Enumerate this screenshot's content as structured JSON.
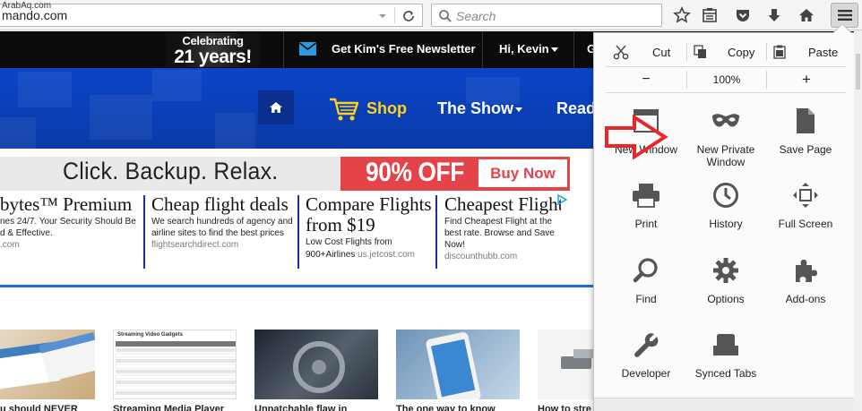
{
  "watermark": "ArabAq.com",
  "toolbar": {
    "url": "mando.com",
    "search_placeholder": "Search"
  },
  "site": {
    "celebrating_top": "Celebrating",
    "celebrating_big": "21 years!",
    "newsletter": "Get Kim's Free Newsletter",
    "greeting": "Hi, Kevin",
    "topbar_cut": "G",
    "nav": {
      "shop": "Shop",
      "show": "The Show",
      "read": "Read"
    }
  },
  "banner_ad": {
    "headline": "Click. Backup. Relax.",
    "offer": "90% OFF",
    "button": "Buy Now"
  },
  "text_ads": [
    {
      "title": "bytes™ Premium",
      "desc": "nes 24/7. Your Security Should Be d & Effective.",
      "url": ".com"
    },
    {
      "title": "Cheap flight deals",
      "desc": "We search hundreds of agency and airline sites to find the best prices",
      "url": "flightsearchdirect.com"
    },
    {
      "title": "Compare Flights from $19",
      "title_line1": "Compare Flights",
      "title_line2": "from $19",
      "desc": "Low Cost Flights from",
      "desc2": "900+Airlines",
      "url": "us.jetcost.com"
    },
    {
      "title": "Cheapest Flight",
      "desc": "Find Cheapest Flight at the best rate. Browse and Save Now!",
      "url": "discounthubb.com"
    }
  ],
  "articles": [
    {
      "caption": "u should NEVER"
    },
    {
      "caption": "Streaming Media Player",
      "thumb_title": "Streaming Video Gadgets"
    },
    {
      "caption": "Unpatchable flaw in"
    },
    {
      "caption": "The one way to know"
    },
    {
      "caption": "How to stre"
    }
  ],
  "menu": {
    "edit": {
      "cut": "Cut",
      "copy": "Copy",
      "paste": "Paste"
    },
    "zoom": {
      "out": "−",
      "level": "100%",
      "in": "+"
    },
    "items": [
      {
        "label": "New Window",
        "icon": "new-window-icon"
      },
      {
        "label": "New Private Window",
        "line1": "New Private",
        "line2": "Window",
        "icon": "private-mask-icon"
      },
      {
        "label": "Save Page",
        "icon": "save-page-icon"
      },
      {
        "label": "Print",
        "icon": "print-icon"
      },
      {
        "label": "History",
        "icon": "history-clock-icon"
      },
      {
        "label": "Full Screen",
        "icon": "full-screen-icon"
      },
      {
        "label": "Find",
        "icon": "find-magnifier-icon"
      },
      {
        "label": "Options",
        "icon": "options-gear-icon"
      },
      {
        "label": "Add-ons",
        "icon": "addons-puzzle-icon"
      },
      {
        "label": "Developer",
        "icon": "developer-wrench-icon"
      },
      {
        "label": "Synced Tabs",
        "icon": "synced-tabs-icon"
      }
    ]
  },
  "colors": {
    "nav_blue": "#0a45c8",
    "shop_yellow": "#ffd21c",
    "offer_red": "#e4434a",
    "annotation_arrow": "#e8262c"
  }
}
